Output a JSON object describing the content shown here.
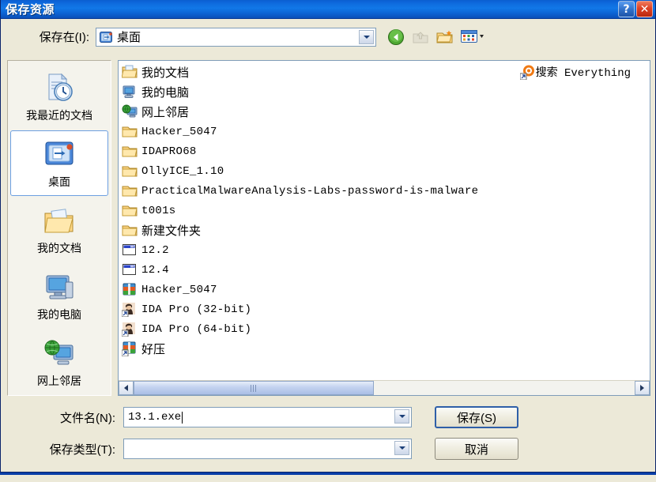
{
  "window": {
    "title": "保存资源",
    "help_button": "?",
    "close_button": "✕",
    "accent_title_color": "#1178e8",
    "dialog_face_color": "#ece9d8"
  },
  "toolbar": {
    "save_in_label": "保存在(I):",
    "current_folder": "桌面",
    "buttons": [
      {
        "name": "back-button",
        "tooltip": "后退",
        "enabled": true
      },
      {
        "name": "up-one-level-button",
        "tooltip": "向上一级",
        "enabled": false
      },
      {
        "name": "new-folder-button",
        "tooltip": "新建文件夹",
        "enabled": true
      },
      {
        "name": "views-button",
        "tooltip": "查看",
        "enabled": true
      }
    ]
  },
  "places_bar": {
    "selected_index": 1,
    "items": [
      {
        "label": "我最近的文档",
        "icon": "recent-documents-icon"
      },
      {
        "label": "桌面",
        "icon": "desktop-icon"
      },
      {
        "label": "我的文档",
        "icon": "my-documents-icon"
      },
      {
        "label": "我的电脑",
        "icon": "my-computer-icon"
      },
      {
        "label": "网上邻居",
        "icon": "network-places-icon"
      }
    ]
  },
  "file_list": {
    "items": [
      {
        "name": "我的文档",
        "icon": "my-documents-icon",
        "mono": false
      },
      {
        "name": "我的电脑",
        "icon": "my-computer-icon",
        "mono": false
      },
      {
        "name": "网上邻居",
        "icon": "network-places-icon",
        "mono": false
      },
      {
        "name": "Hacker_5047",
        "icon": "folder-icon",
        "mono": true
      },
      {
        "name": "IDAPRO68",
        "icon": "folder-icon",
        "mono": true
      },
      {
        "name": "OllyICE_1.10",
        "icon": "folder-icon",
        "mono": true
      },
      {
        "name": "PracticalMalwareAnalysis-Labs-password-is-malware",
        "icon": "folder-icon",
        "mono": true
      },
      {
        "name": "t001s",
        "icon": "folder-icon",
        "mono": true
      },
      {
        "name": "新建文件夹",
        "icon": "folder-icon",
        "mono": false
      },
      {
        "name": "12.2",
        "icon": "window-document-icon",
        "mono": true
      },
      {
        "name": "12.4",
        "icon": "window-document-icon",
        "mono": true
      },
      {
        "name": "Hacker_5047",
        "icon": "rar-archive-icon",
        "mono": true
      },
      {
        "name": "IDA Pro (32-bit)",
        "icon": "ida-pro-shortcut-icon",
        "mono": true
      },
      {
        "name": "IDA Pro (64-bit)",
        "icon": "ida-pro-shortcut-icon",
        "mono": true
      },
      {
        "name": "好压",
        "icon": "haozip-shortcut-icon",
        "mono": false
      }
    ],
    "secondary_column": [
      {
        "name": "搜索 Everything",
        "icon": "everything-search-shortcut-icon"
      }
    ],
    "scrollbar": {
      "left_arrow": "◀",
      "right_arrow": "▶",
      "thumb_start_percent": 0,
      "thumb_width_percent": 48
    }
  },
  "form": {
    "file_name_label": "文件名(N):",
    "file_name_value": "13.1.exe",
    "file_type_label": "保存类型(T):",
    "file_type_value": "",
    "save_button": "保存(S)",
    "cancel_button": "取消"
  }
}
